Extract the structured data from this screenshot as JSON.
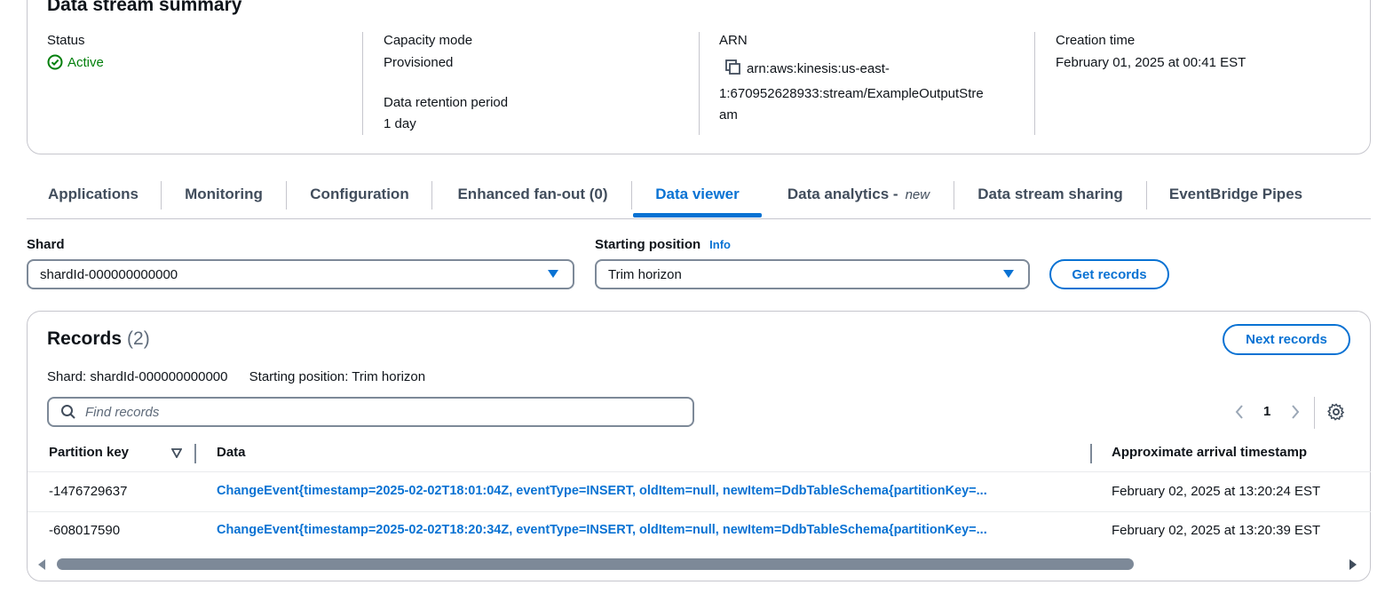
{
  "summary": {
    "title": "Data stream summary",
    "status_label": "Status",
    "status_value": "Active",
    "capacity_label": "Capacity mode",
    "capacity_value": "Provisioned",
    "retention_label": "Data retention period",
    "retention_value": "1 day",
    "arn_label": "ARN",
    "arn_value_line1": "arn:aws:kinesis:us-east-",
    "arn_value_line2": "1:670952628933:stream/ExampleOutputStre",
    "arn_value_line3": "am",
    "creation_label": "Creation time",
    "creation_value": "February 01, 2025 at 00:41 EST"
  },
  "tabs": [
    {
      "label": "Applications"
    },
    {
      "label": "Monitoring"
    },
    {
      "label": "Configuration"
    },
    {
      "label": "Enhanced fan-out (0)"
    },
    {
      "label": "Data viewer"
    },
    {
      "label": "Data analytics -",
      "badge": "new"
    },
    {
      "label": "Data stream sharing"
    },
    {
      "label": "EventBridge Pipes"
    }
  ],
  "filters": {
    "shard_label": "Shard",
    "shard_value": "shardId-000000000000",
    "position_label": "Starting position",
    "position_info": "Info",
    "position_value": "Trim horizon",
    "get_records": "Get records"
  },
  "records": {
    "title": "Records",
    "count": "(2)",
    "next_button": "Next records",
    "meta_shard": "Shard: shardId-000000000000",
    "meta_position": "Starting position: Trim horizon",
    "search_placeholder": "Find records",
    "page": "1",
    "columns": [
      "Partition key",
      "Data",
      "Approximate arrival timestamp"
    ],
    "rows": [
      {
        "key": "-1476729637",
        "data": "ChangeEvent{timestamp=2025-02-02T18:01:04Z, eventType=INSERT, oldItem=null, newItem=DdbTableSchema{partitionKey=...",
        "time": "February 02, 2025 at 13:20:24 EST"
      },
      {
        "key": "-608017590",
        "data": "ChangeEvent{timestamp=2025-02-02T18:20:34Z, eventType=INSERT, oldItem=null, newItem=DdbTableSchema{partitionKey=...",
        "time": "February 02, 2025 at 13:20:39 EST"
      }
    ]
  },
  "colors": {
    "accent": "#0972d3",
    "success": "#037f0c",
    "border": "#c6c6cd"
  }
}
